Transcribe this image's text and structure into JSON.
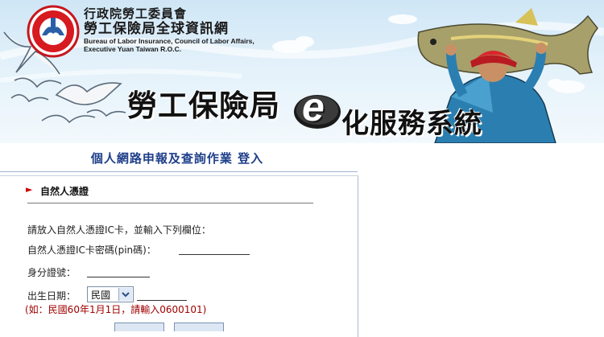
{
  "header": {
    "org_line1": "行政院勞工委員會",
    "org_line2": "勞工保險局全球資訊網",
    "org_english": "Bureau of Labor Insurance, Council of Labor Affairs, Executive Yuan Taiwan R.O.C.",
    "system_title_left": "勞工保險局",
    "system_title_e": "e",
    "system_title_right": "化服務系統"
  },
  "page": {
    "title": "個人網路申報及查詢作業 登入"
  },
  "form": {
    "section_title": "自然人憑證",
    "instruction": "請放入自然人憑證IC卡，並輸入下列欄位：",
    "pin_label": "自然人憑證IC卡密碼(pin碼)：",
    "pin_value": "",
    "id_label": "身分證號：",
    "id_value": "",
    "birth_label": "出生日期：",
    "era_selected": "民國",
    "birth_value": "",
    "birth_hint": "(如：民國60年1月1日，請輸入0600101)"
  },
  "colors": {
    "title_blue": "#1f3f8a",
    "hint_red": "#a00000",
    "arrow_red": "#d00000"
  },
  "icons": {
    "logo": "bureau-seal-logo",
    "section_marker": "triangle-right-icon",
    "dropdown": "chevron-down-icon"
  }
}
